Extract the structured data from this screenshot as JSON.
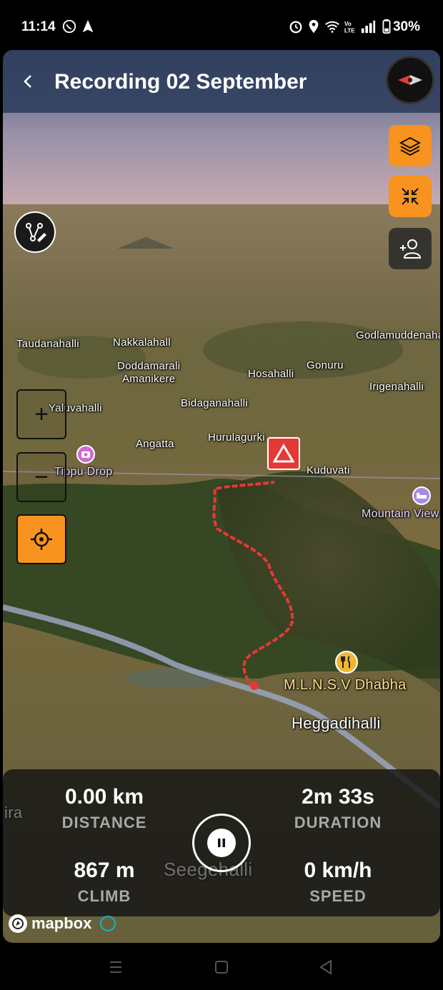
{
  "status_bar": {
    "time": "11:14",
    "battery": "30%",
    "icons": [
      "whatsapp-icon",
      "navigation-arrow-icon",
      "alarm-icon",
      "location-pin-icon",
      "wifi-icon",
      "volte-icon",
      "signal-icon",
      "battery-icon"
    ]
  },
  "header": {
    "back_icon": "chevron-left-icon",
    "title": "Recording 02 September",
    "compass_icon": "compass-icon"
  },
  "controls": {
    "layers_icon": "layers-icon",
    "collapse_icon": "collapse-arrows-icon",
    "add_person_icon": "add-user-icon",
    "route_edit_icon": "route-edit-icon",
    "zoom_in": "+",
    "zoom_out": "−",
    "locate_icon": "crosshair-icon",
    "accent_color": "#f7931e"
  },
  "map_labels": {
    "taudanahalli": "Taudanahalli",
    "nakkalahall": "Nakkalahall",
    "godlamuddenahal": "Godlamuddenahal",
    "doddamarali": "Doddamarali",
    "amanikere": "Amanikere",
    "hosahalli": "Hosahalli",
    "gonuru": "Gonuru",
    "irigenahalli": "Irigenahalli",
    "yaluvahalli": "Yaluvahalli",
    "bidaganahalli": "Bidaganahalli",
    "angatta": "Angatta",
    "hurulagurki": "Hurulagurki",
    "tippu_drop": "Tippu Drop",
    "kuduvati": "Kuduvati",
    "mountain_view": "Mountain View",
    "dhabha": "M.L.N.S.V Dhabha",
    "heggadihalli": "Heggadihalli",
    "seegehalli": "Seegehalli",
    "ira": "ira"
  },
  "track_color": "#e53935",
  "stats": {
    "distance_value": "0.00 km",
    "distance_label": "DISTANCE",
    "duration_value": "2m 33s",
    "duration_label": "DURATION",
    "climb_value": "867 m",
    "climb_label": "CLIMB",
    "speed_value": "0 km/h",
    "speed_label": "SPEED",
    "pause_icon": "pause-icon"
  },
  "attribution": {
    "brand": "mapbox"
  },
  "nav_bar": {
    "icons": [
      "recents-icon",
      "home-icon",
      "back-triangle-icon"
    ]
  }
}
